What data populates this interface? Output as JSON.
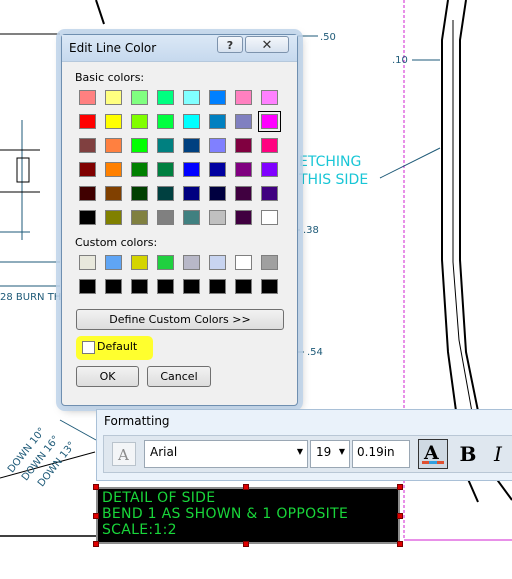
{
  "drawing": {
    "dimensions": [
      ".50",
      ".10",
      ".38",
      ".54"
    ],
    "leader_note_lines": [
      "ETCHING",
      "THIS SIDE"
    ],
    "left_note": "28 BURN TH",
    "angled_notes": [
      "DOWN 10°",
      "DOWN 16°",
      "DOWN 13°"
    ]
  },
  "dialog": {
    "title": "Edit Line Color",
    "help_label": "?",
    "close_label": "✕",
    "basic_colors_label": "Basic colors:",
    "basic_colors": [
      "#ff8080",
      "#ffff80",
      "#80ff80",
      "#00ff80",
      "#80ffff",
      "#0080ff",
      "#ff80c0",
      "#ff80ff",
      "#ff0000",
      "#ffff00",
      "#80ff00",
      "#00ff40",
      "#00ffff",
      "#0080c0",
      "#8080c0",
      "#ff00ff",
      "#804040",
      "#ff8040",
      "#00ff00",
      "#008080",
      "#004080",
      "#8080ff",
      "#800040",
      "#ff0080",
      "#800000",
      "#ff8000",
      "#008000",
      "#008040",
      "#0000ff",
      "#0000a0",
      "#800080",
      "#8000ff",
      "#400000",
      "#804000",
      "#004000",
      "#004040",
      "#000080",
      "#000040",
      "#400040",
      "#400080",
      "#000000",
      "#808000",
      "#808040",
      "#808080",
      "#408080",
      "#c0c0c0",
      "#400040",
      "#ffffff"
    ],
    "selected_basic_index": 15,
    "custom_colors_label": "Custom colors:",
    "custom_colors": [
      "#e8e8dc",
      "#5fa5f5",
      "#d4d400",
      "#20d040",
      "#b8b8c8",
      "#c8d4f0",
      "#ffffff",
      "#a0a0a0",
      "#000000",
      "#000000",
      "#000000",
      "#000000",
      "#000000",
      "#000000",
      "#000000",
      "#000000"
    ],
    "define_custom_label": "Define Custom Colors >>",
    "default_label": "Default",
    "default_checked": false,
    "ok_label": "OK",
    "cancel_label": "Cancel"
  },
  "formatting": {
    "title": "Formatting",
    "font_name": "Arial",
    "font_size": "19",
    "text_height": "0.19in",
    "bold_label": "B",
    "italic_label": "I"
  },
  "note": {
    "lines": [
      "DETAIL OF SIDE",
      "BEND 1 AS SHOWN & 1 OPPOSITE",
      "SCALE:1:2"
    ]
  }
}
